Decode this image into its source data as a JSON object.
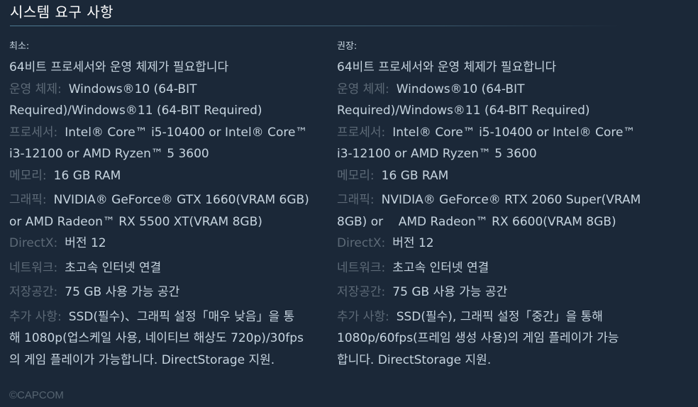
{
  "page": {
    "title": "시스템 요구 사항",
    "copyright": "©CAPCOM"
  },
  "minimum": {
    "heading": "최소:",
    "requires_64bit": "64비트 프로세서와 운영 체제가 필요합니다",
    "os_label": "운영 체제:",
    "os_line1": "Windows®10 (64-BIT",
    "os_line2": "Required)/Windows®11 (64-BIT Required)",
    "cpu_label": "프로세서:",
    "cpu_line1": "Intel® Core™ i5-10400 or Intel® Core™",
    "cpu_line2": "i3-12100 or AMD Ryzen™ 5 3600",
    "memory_label": "메모리:",
    "memory_value": "16 GB RAM",
    "gpu_label": "그래픽:",
    "gpu_line1": "NVIDIA® GeForce® GTX 1660(VRAM 6GB)",
    "gpu_line2": "or AMD Radeon™ RX 5500 XT(VRAM 8GB)",
    "directx_label": "DirectX:",
    "directx_value": "버전 12",
    "network_label": "네트워크:",
    "network_value": "초고속 인터넷 연결",
    "storage_label": "저장공간:",
    "storage_value": "75 GB 사용 가능 공간",
    "notes_label": "추가 사항:",
    "notes_line1": "SSD(필수)、그래픽 설정「매우 낮음」을 통",
    "notes_line2": "해 1080p(업스케일 사용, 네이티브 해상도 720p)/30fps",
    "notes_line3": "의 게임 플레이가 가능합니다. DirectStorage 지원."
  },
  "recommended": {
    "heading": "권장:",
    "requires_64bit": "64비트 프로세서와 운영 체제가 필요합니다",
    "os_label": "운영 체제:",
    "os_line1": "Windows®10 (64-BIT",
    "os_line2": "Required)/Windows®11 (64-BIT Required)",
    "cpu_label": "프로세서:",
    "cpu_line1": "Intel® Core™ i5-10400 or Intel® Core™",
    "cpu_line2": "i3-12100 or AMD Ryzen™ 5 3600",
    "memory_label": "메모리:",
    "memory_value": "16 GB RAM",
    "gpu_label": "그래픽:",
    "gpu_line1": "NVIDIA® GeForce® RTX 2060 Super(VRAM",
    "gpu_line2": "8GB) or    AMD Radeon™ RX 6600(VRAM 8GB)",
    "directx_label": "DirectX:",
    "directx_value": "버전 12",
    "network_label": "네트워크:",
    "network_value": "초고속 인터넷 연결",
    "storage_label": "저장공간:",
    "storage_value": "75 GB 사용 가능 공간",
    "notes_label": "추가 사항:",
    "notes_line1": "SSD(필수), 그래픽 설정「중간」을 통해",
    "notes_line2": "1080p/60fps(프레임 생성 사용)의 게임 플레이가 가능",
    "notes_line3": "합니다. DirectStorage 지원."
  },
  "colors": {
    "background": "#1b2838",
    "text": "#c6d4df",
    "label": "#5d6a77",
    "title": "#ffffff",
    "rule": "#4e7a92"
  }
}
